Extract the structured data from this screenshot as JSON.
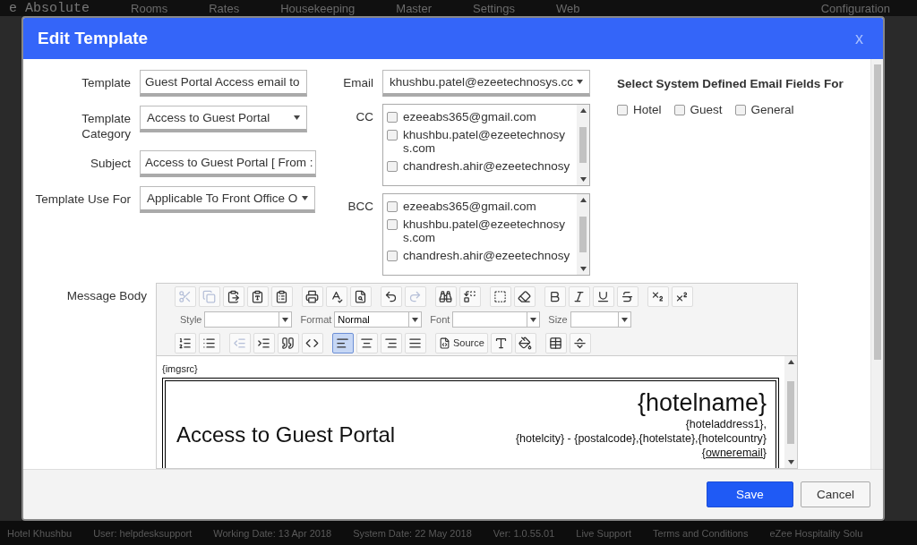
{
  "app_nav": {
    "logo": "e Absolute",
    "items": [
      "Rooms",
      "Rates",
      "Housekeeping",
      "Master",
      "Settings",
      "Web"
    ],
    "right": "Configuration"
  },
  "dialog": {
    "title": "Edit Template",
    "close": "x",
    "template": {
      "label": "Template",
      "value": "Guest Portal Access email to"
    },
    "category": {
      "label": "Template Category",
      "value": "Access to Guest Portal"
    },
    "subject": {
      "label": "Subject",
      "value": "Access to Guest Portal [ From :"
    },
    "use_for": {
      "label": "Template Use For",
      "value": "Applicable To Front Office O"
    },
    "email": {
      "label": "Email",
      "value": "khushbu.patel@ezeetechnosys.cc"
    },
    "cc": {
      "label": "CC",
      "items": [
        {
          "text": "ezeeabs365@gmail.com",
          "checked": false
        },
        {
          "text": "khushbu.patel@ezeetechnosys.com",
          "checked": false
        },
        {
          "text": "chandresh.ahir@ezeetechnosy",
          "checked": false
        }
      ]
    },
    "bcc": {
      "label": "BCC",
      "items": [
        {
          "text": "ezeeabs365@gmail.com",
          "checked": false
        },
        {
          "text": "khushbu.patel@ezeetechnosys.com",
          "checked": false
        },
        {
          "text": "chandresh.ahir@ezeetechnosy",
          "checked": false
        }
      ]
    },
    "system_fields": {
      "heading": "Select System Defined Email Fields For",
      "options": [
        {
          "label": "Hotel",
          "checked": false
        },
        {
          "label": "Guest",
          "checked": false
        },
        {
          "label": "General",
          "checked": false
        }
      ]
    },
    "message_body": {
      "label": "Message Body",
      "toolbar_1": [
        {
          "disabled": true
        },
        {
          "disabled": true
        },
        {
          "disabled": false
        },
        {
          "disabled": false
        },
        {
          "disabled": false
        },
        {
          "disabled": false
        },
        {
          "disabled": false
        },
        {
          "disabled": false
        },
        {
          "disabled": false
        },
        {
          "disabled": true
        },
        {
          "disabled": false
        },
        {
          "disabled": false
        },
        {
          "disabled": false
        },
        {
          "disabled": false
        },
        {
          "disabled": false
        },
        {
          "disabled": false
        },
        {
          "disabled": false
        },
        {
          "disabled": false
        },
        {
          "disabled": false
        },
        {
          "disabled": false
        }
      ],
      "combos": [
        {
          "label": "Style"
        },
        {
          "label": "Format",
          "value": "Normal"
        },
        {
          "label": "Font"
        },
        {
          "label": "Size"
        }
      ],
      "toolbar_3": [
        {
          "disabled": false,
          "selected": false
        },
        {
          "disabled": false,
          "selected": false
        },
        {
          "disabled": true,
          "selected": false
        },
        {
          "disabled": false,
          "selected": false
        },
        {
          "disabled": false,
          "selected": false
        },
        {
          "disabled": false,
          "selected": false
        },
        {
          "disabled": false,
          "selected": true
        },
        {
          "disabled": false,
          "selected": false
        },
        {
          "disabled": false,
          "selected": false
        },
        {
          "disabled": false,
          "selected": false
        }
      ],
      "source": "Source",
      "content": {
        "imgsrc": "{imgsrc}",
        "heading": "Access to Guest Portal",
        "hotelname": "{hotelname}",
        "address": [
          "{hoteladdress1},",
          "{hotelcity} - {postalcode},{hotelstate},{hotelcountry}"
        ],
        "owneremail": "{owneremail}"
      }
    },
    "buttons": [
      "Save",
      "Cancel"
    ]
  },
  "status_bar": [
    "Hotel Khushbu",
    "User: helpdesksupport",
    "Working Date: 13 Apr 2018",
    "System Date: 22 May 2018",
    "Ver: 1.0.55.01",
    "Live Support",
    "Terms and Conditions",
    "eZee Hospitality Solu"
  ]
}
